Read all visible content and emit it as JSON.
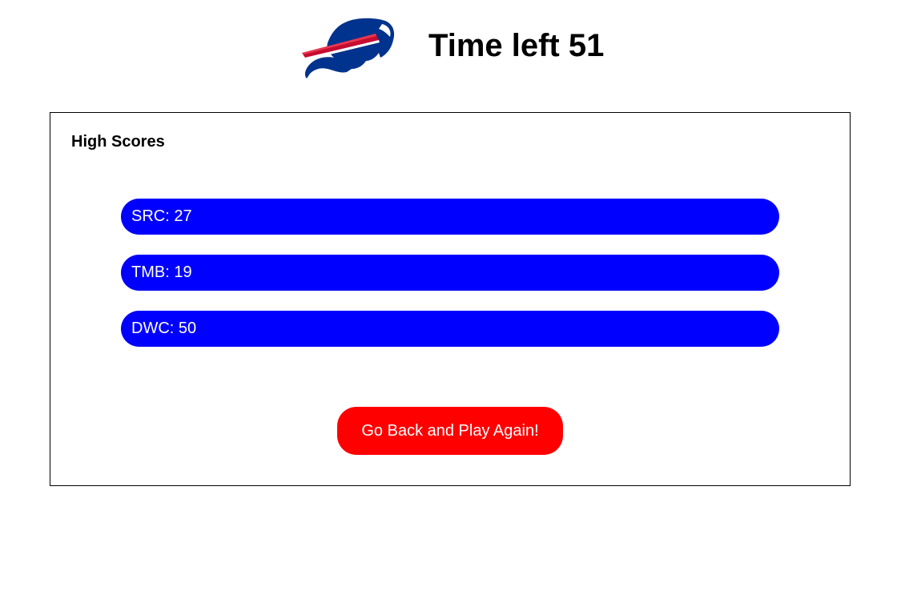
{
  "header": {
    "logo_icon": "bison-logo-icon",
    "timer_text": "Time left 51"
  },
  "high_scores": {
    "title": "High Scores",
    "entries": [
      {
        "label": "SRC: 27"
      },
      {
        "label": "TMB: 19"
      },
      {
        "label": "DWC: 50"
      }
    ]
  },
  "actions": {
    "back_button_label": "Go Back and Play Again!"
  },
  "colors": {
    "score_bar": "#0000ff",
    "button": "#ff0000",
    "logo_blue": "#00338d",
    "logo_red": "#c60c30"
  }
}
